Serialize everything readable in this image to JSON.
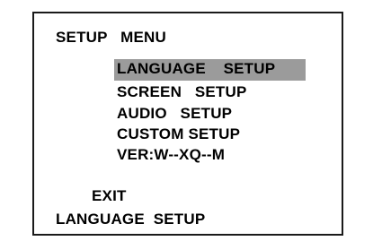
{
  "menu": {
    "title": "SETUP   MENU",
    "items": [
      {
        "label": "LANGUAGE    SETUP",
        "selected": true
      },
      {
        "label": "SCREEN   SETUP",
        "selected": false
      },
      {
        "label": "AUDIO   SETUP",
        "selected": false
      },
      {
        "label": "CUSTOM SETUP",
        "selected": false
      },
      {
        "label": "VER:W--XQ--M",
        "selected": false
      }
    ],
    "exit_label": "EXIT",
    "status_text": "LANGUAGE  SETUP"
  },
  "colors": {
    "background": "#ffffff",
    "text": "#000000",
    "highlight": "#9b9b9b",
    "border": "#1a1a1a"
  }
}
